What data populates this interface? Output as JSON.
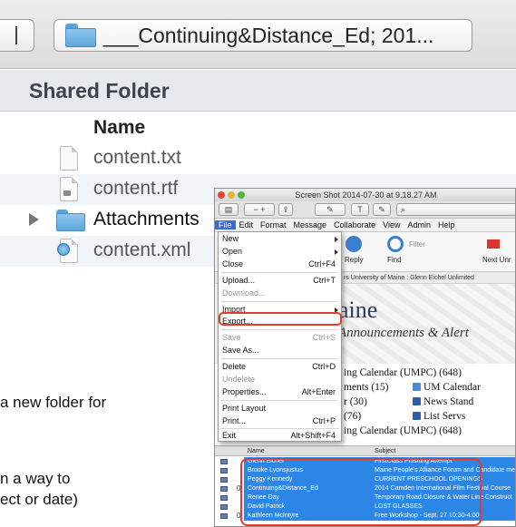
{
  "finder": {
    "path_label": "___Continuing&Distance_Ed; 201...",
    "section_title": "Shared Folder",
    "column_name": "Name",
    "items": [
      {
        "label": "content.txt",
        "icon": "text-file-icon"
      },
      {
        "label": "content.rtf",
        "icon": "rtf-file-icon"
      },
      {
        "label": "Attachments",
        "icon": "folder-icon"
      },
      {
        "label": "content.xml",
        "icon": "xml-file-icon"
      }
    ]
  },
  "document": {
    "fragment_1": "a new folder for",
    "fragment_2": "n a way to",
    "fragment_3": "ect or date)"
  },
  "screenshot": {
    "window_title": "Screen Shot 2014-07-30 at 9.18.27 AM",
    "menubar": [
      "File",
      "Edit",
      "Format",
      "Message",
      "Collaborate",
      "View",
      "Admin",
      "Help"
    ],
    "ribbon": {
      "reply": "Reply",
      "find": "Find",
      "filter_placeholder": "Filter",
      "next_unread": "Next Unr"
    },
    "crumb": "rs   University of Maine : Glenn Eichel                         Unlimited",
    "banner_title": "aine",
    "banner_subtitle": "Announcements & Alert",
    "links": {
      "l1": "ing Calendar (UMPC) (648)",
      "l2": "ments (15)",
      "l2b": "UM Calendar",
      "l3": "r (30)",
      "l3b": "News Stand",
      "l4": "(76)",
      "l4b": "List Servs",
      "l5": "ing Calendar (UMPC) (648)"
    },
    "file_menu": [
      {
        "label": "New",
        "shortcut": "",
        "submenu": true,
        "disabled": false
      },
      {
        "label": "Open",
        "shortcut": "",
        "submenu": true,
        "disabled": false
      },
      {
        "label": "Close",
        "shortcut": "Ctrl+F4",
        "submenu": false,
        "disabled": false
      },
      {
        "label": "Upload...",
        "shortcut": "Ctrl+T",
        "submenu": false,
        "disabled": false
      },
      {
        "label": "Download...",
        "shortcut": "",
        "submenu": false,
        "disabled": true
      },
      {
        "label": "Import",
        "shortcut": "",
        "submenu": true,
        "disabled": false
      },
      {
        "label": "Export...",
        "shortcut": "",
        "submenu": false,
        "disabled": false
      },
      {
        "label": "Save",
        "shortcut": "Ctrl+S",
        "submenu": false,
        "disabled": true
      },
      {
        "label": "Save As...",
        "shortcut": "",
        "submenu": false,
        "disabled": false
      },
      {
        "label": "Delete",
        "shortcut": "Ctrl+D",
        "submenu": false,
        "disabled": false
      },
      {
        "label": "Undelete",
        "shortcut": "",
        "submenu": false,
        "disabled": true
      },
      {
        "label": "Properties...",
        "shortcut": "Alt+Enter",
        "submenu": false,
        "disabled": false
      },
      {
        "label": "Print Layout",
        "shortcut": "",
        "submenu": false,
        "disabled": false
      },
      {
        "label": "Print...",
        "shortcut": "Ctrl+P",
        "submenu": false,
        "disabled": false
      },
      {
        "label": "Exit",
        "shortcut": "Alt+Shift+F4",
        "submenu": false,
        "disabled": false
      }
    ],
    "mail_header": {
      "name": "Name",
      "subject": "Subject"
    },
    "mail_rows": [
      {
        "name": "Glenn Eichel",
        "subject": "FirstClass Phishing Attempt",
        "attach": ""
      },
      {
        "name": "Brooke Lyonsjustus",
        "subject": "Maine People's Alliance Forum and Candidate meet",
        "attach": ""
      },
      {
        "name": "Peggy Kennedy",
        "subject": "CURRENT PRESCHOOL OPENINGS",
        "attach": ""
      },
      {
        "name": "Continuing&Distance_Ed",
        "subject": "2014 Camden International Film Festival Course",
        "attach": "0"
      },
      {
        "name": "Renee Day",
        "subject": "Temporary Road Closure & Water Line Construct",
        "attach": ""
      },
      {
        "name": "David Patrick",
        "subject": "LOST GLASSES",
        "attach": ""
      },
      {
        "name": "Kathleen McIntyre",
        "subject": "Free Workshop - Sept. 27 10:30-4:00",
        "attach": "0"
      }
    ],
    "colors": {
      "selection": "#2c86e6",
      "highlight": "#e33c2e",
      "menu_active": "#3a6bd6"
    }
  }
}
